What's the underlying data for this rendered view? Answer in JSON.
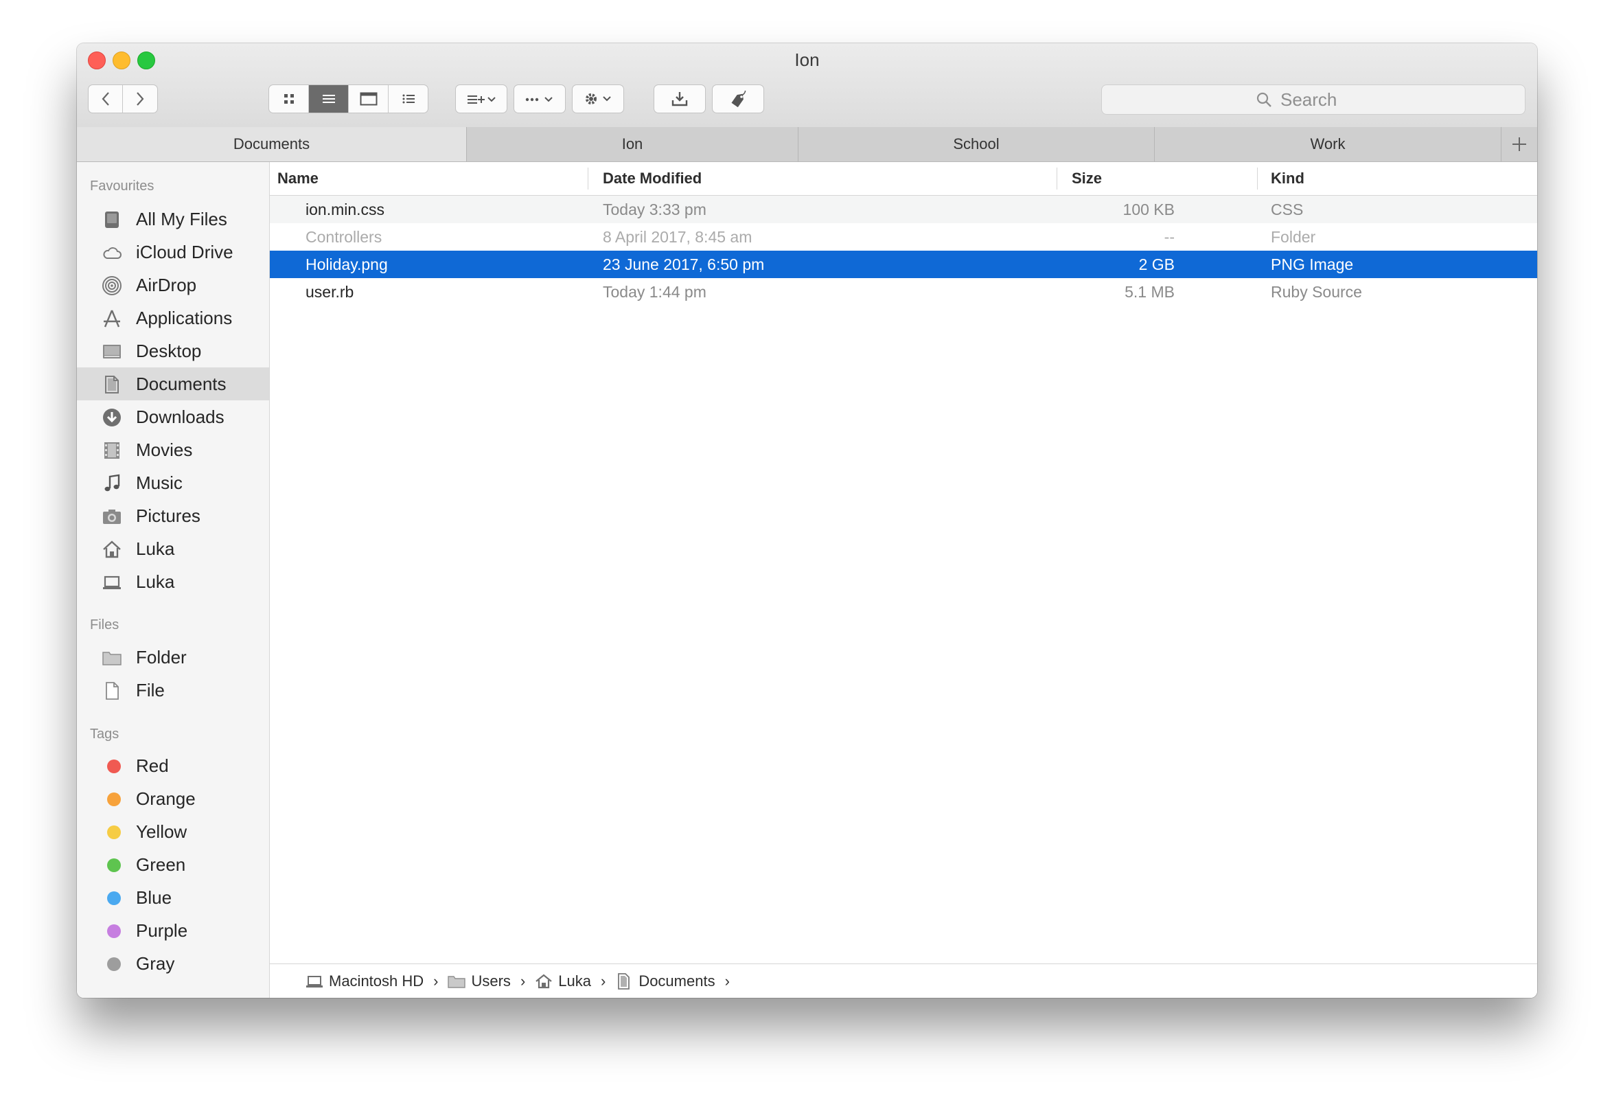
{
  "window": {
    "title": "Ion"
  },
  "toolbar": {
    "search_placeholder": "Search",
    "view_modes": [
      "icon-view",
      "list-view",
      "column-view",
      "gallery-view"
    ],
    "active_view": "list-view"
  },
  "tabs": [
    {
      "label": "Documents",
      "active": true
    },
    {
      "label": "Ion",
      "active": false
    },
    {
      "label": "School",
      "active": false
    },
    {
      "label": "Work",
      "active": false
    }
  ],
  "sidebar": {
    "favourites_header": "Favourites",
    "favourites": [
      {
        "label": "All My Files",
        "icon": "all-files-icon"
      },
      {
        "label": "iCloud Drive",
        "icon": "cloud-icon"
      },
      {
        "label": "AirDrop",
        "icon": "airdrop-icon"
      },
      {
        "label": "Applications",
        "icon": "applications-icon"
      },
      {
        "label": "Desktop",
        "icon": "desktop-icon"
      },
      {
        "label": "Documents",
        "icon": "documents-icon",
        "selected": true
      },
      {
        "label": "Downloads",
        "icon": "downloads-icon"
      },
      {
        "label": "Movies",
        "icon": "movies-icon"
      },
      {
        "label": "Music",
        "icon": "music-icon"
      },
      {
        "label": "Pictures",
        "icon": "camera-icon"
      },
      {
        "label": "Luka",
        "icon": "home-icon"
      },
      {
        "label": "Luka",
        "icon": "laptop-icon"
      }
    ],
    "files_header": "Files",
    "files": [
      {
        "label": "Folder",
        "icon": "folder-icon"
      },
      {
        "label": "File",
        "icon": "file-icon"
      }
    ],
    "tags_header": "Tags",
    "tags": [
      {
        "label": "Red",
        "color": "#f05a52"
      },
      {
        "label": "Orange",
        "color": "#f7a23b"
      },
      {
        "label": "Yellow",
        "color": "#f6cc44"
      },
      {
        "label": "Green",
        "color": "#5ec44f"
      },
      {
        "label": "Blue",
        "color": "#4aa9f0"
      },
      {
        "label": "Purple",
        "color": "#c67ee0"
      },
      {
        "label": "Gray",
        "color": "#9d9d9d"
      }
    ]
  },
  "table": {
    "columns": [
      "Name",
      "Date Modified",
      "Size",
      "Kind"
    ],
    "rows": [
      {
        "name": "ion.min.css",
        "date": "Today 3:33 pm",
        "size": "100 KB",
        "kind": "CSS",
        "state": "normal"
      },
      {
        "name": "Controllers",
        "date": "8 April 2017, 8:45 am",
        "size": "--",
        "kind": "Folder",
        "state": "dim"
      },
      {
        "name": "Holiday.png",
        "date": "23 June 2017, 6:50 pm",
        "size": "2 GB",
        "kind": "PNG Image",
        "state": "selected"
      },
      {
        "name": "user.rb",
        "date": "Today 1:44 pm",
        "size": "5.1 MB",
        "kind": "Ruby Source",
        "state": "normal"
      }
    ]
  },
  "pathbar": [
    {
      "label": "Macintosh HD",
      "icon": "laptop-icon"
    },
    {
      "label": "Users",
      "icon": "folder-icon"
    },
    {
      "label": "Luka",
      "icon": "home-icon"
    },
    {
      "label": "Documents",
      "icon": "documents-icon"
    }
  ],
  "colors": {
    "selection": "#0f69d6",
    "sidebar_bg": "#f5f5f5"
  }
}
